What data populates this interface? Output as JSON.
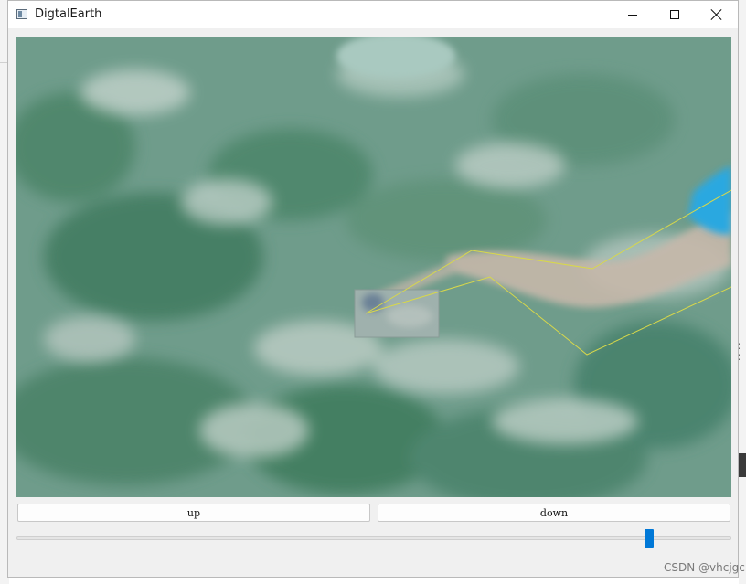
{
  "window": {
    "title": "DigtalEarth",
    "minimize_glyph": "minimize",
    "maximize_glyph": "maximize",
    "close_glyph": "close"
  },
  "toolbar": {
    "up_label": "up",
    "down_label": "down"
  },
  "slider": {
    "value_fraction": 0.89
  },
  "watermark": "CSDN @vhcjgc",
  "colors": {
    "map_base": "#6e9b8a",
    "track_line": "#d8d84a",
    "slider_handle": "#0078d7",
    "river": "#c9b9a8",
    "lake": "#2aa8e0"
  },
  "icons": {
    "app": "app-window-icon",
    "minimize": "minimize-icon",
    "maximize": "maximize-icon",
    "close": "close-icon"
  }
}
